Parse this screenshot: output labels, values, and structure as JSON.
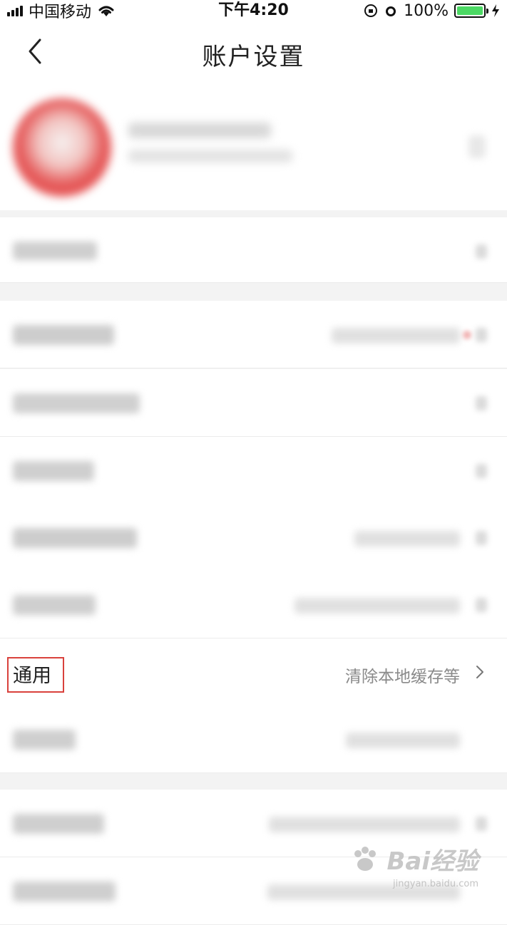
{
  "statusbar": {
    "carrier": "中国移动",
    "time": "下午4:20",
    "battery_text": "100%"
  },
  "nav": {
    "title": "账户设置"
  },
  "rows": {
    "general": {
      "label": "通用",
      "value": "清除本地缓存等"
    }
  },
  "colors": {
    "accent_highlight": "#d9413c",
    "battery_green": "#4cd964",
    "background": "#f3f3f3"
  },
  "watermark": {
    "text": "Bai经验",
    "sub": "jingyan.baidu.com"
  }
}
